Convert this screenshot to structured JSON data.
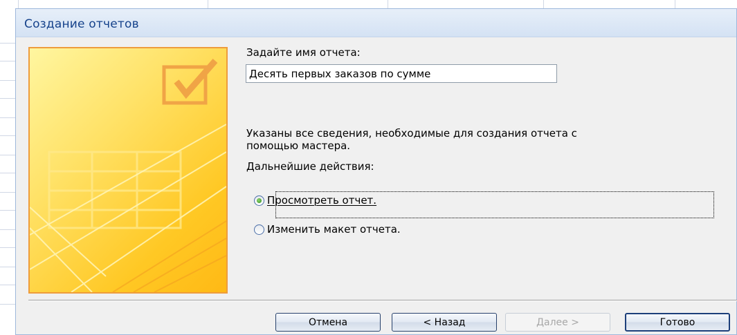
{
  "dialog": {
    "title": "Создание отчетов",
    "name_prompt": "Задайте имя отчета:",
    "report_name": "Десять первых заказов по сумме",
    "info_text_line1": "Указаны все сведения, необходимые для создания отчета с",
    "info_text_line2": "помощью мастера.",
    "next_actions_label": "Дальнейшие действия:",
    "options": [
      {
        "label": "Просмотреть отчет.",
        "selected": true
      },
      {
        "label": "Изменить макет отчета.",
        "selected": false
      }
    ],
    "buttons": {
      "cancel": "Отмена",
      "back": "< Назад",
      "next": "Далее >",
      "finish": "Готово"
    }
  },
  "colors": {
    "title_text": "#15428b",
    "banner_border": "#ee9c3c",
    "banner_fill": "#ffc824"
  }
}
